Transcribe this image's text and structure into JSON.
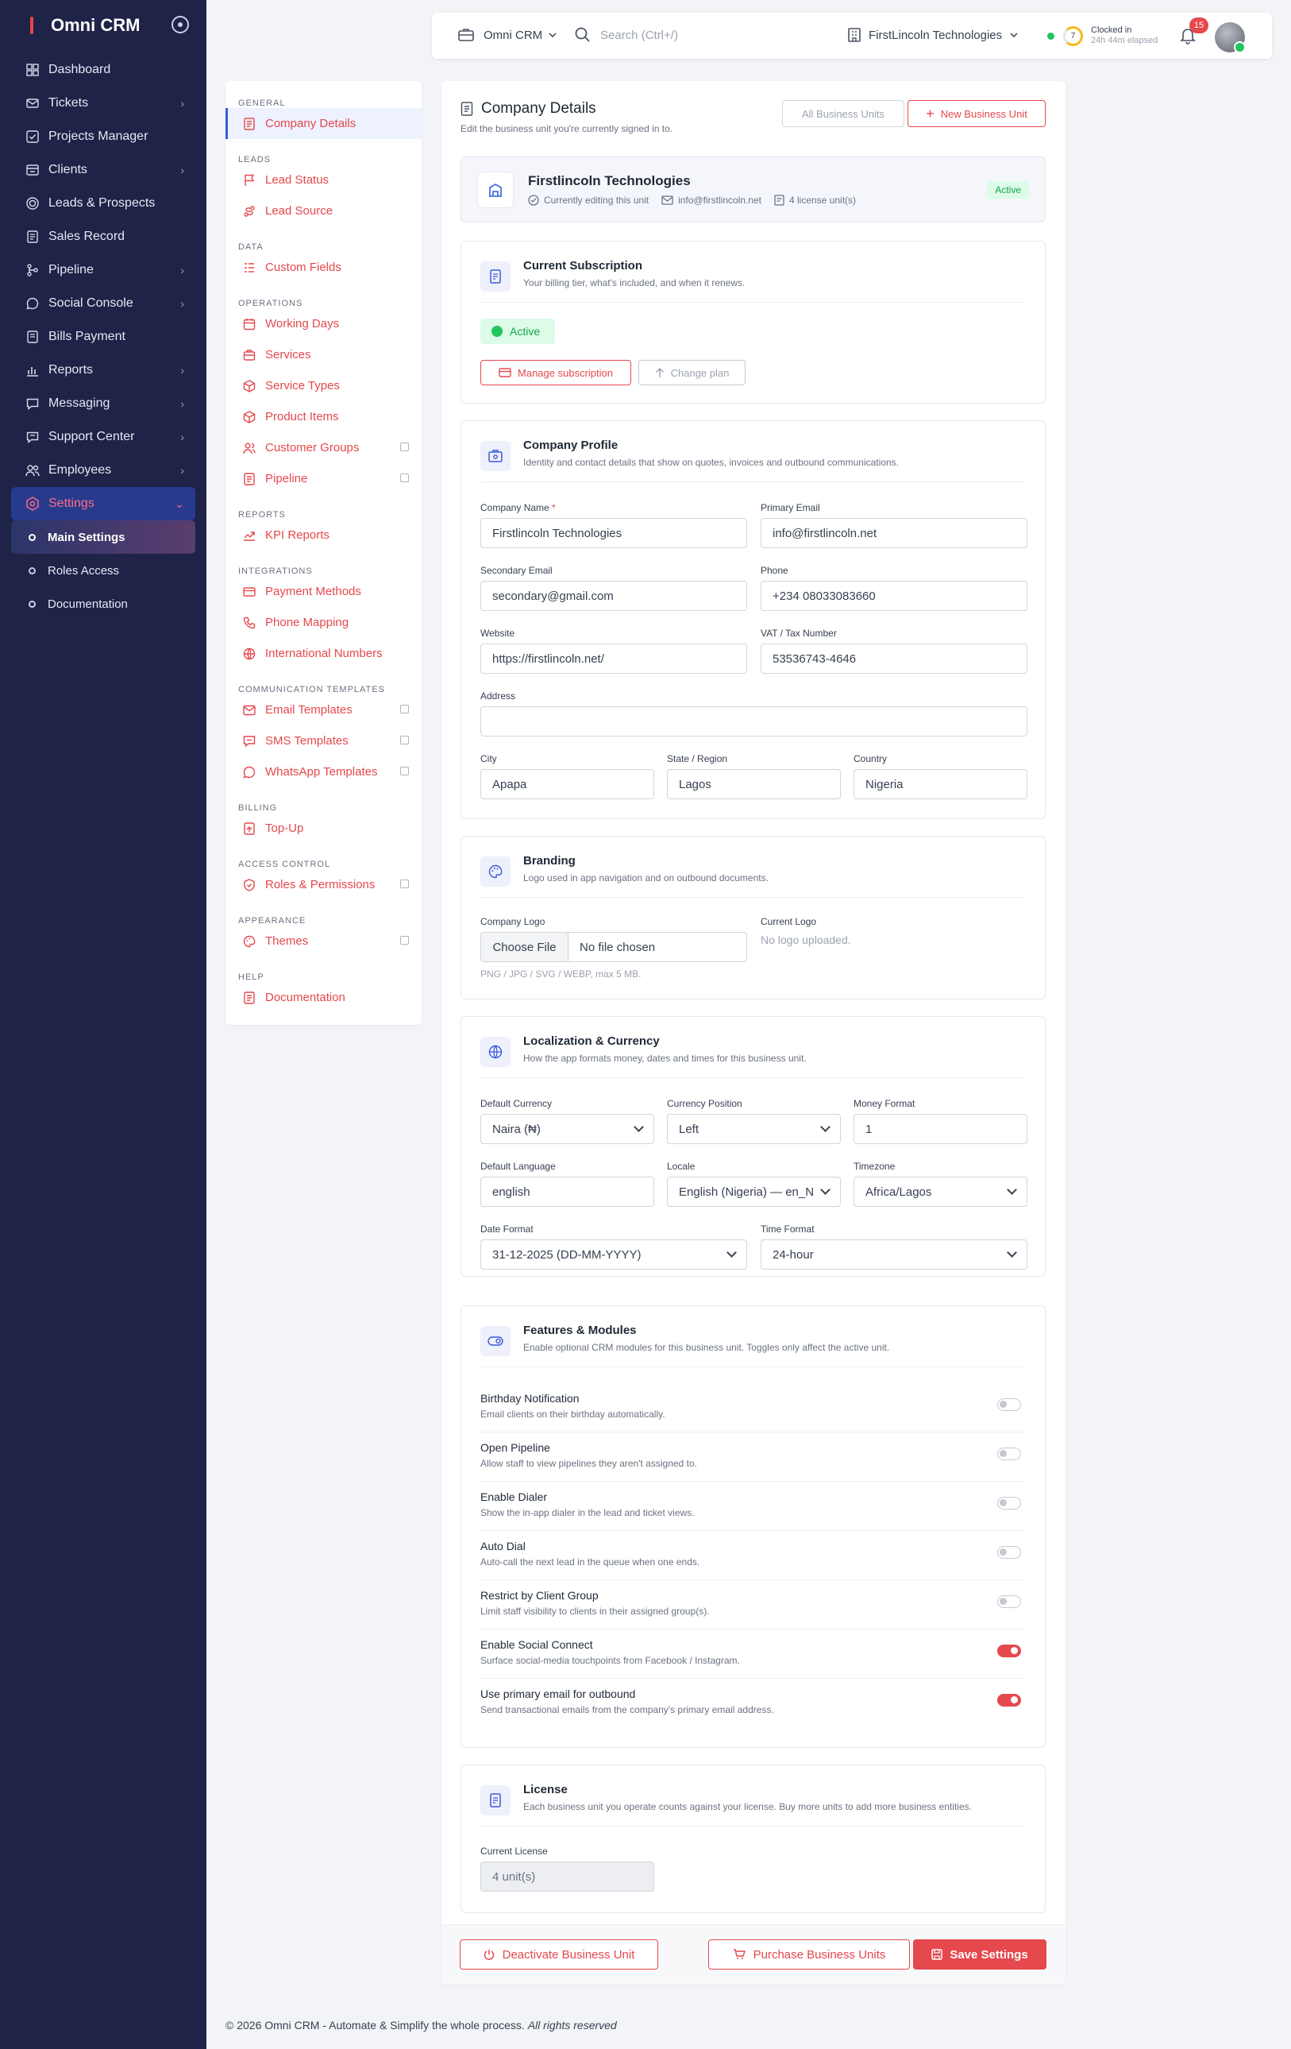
{
  "sidebar": {
    "title": "Omni CRM",
    "items": [
      {
        "label": "Dashboard",
        "icon": "dashboard-icon",
        "chevron": false
      },
      {
        "label": "Tickets",
        "icon": "ticket-icon",
        "chevron": true
      },
      {
        "label": "Projects Manager",
        "icon": "checkbox-icon",
        "chevron": false
      },
      {
        "label": "Clients",
        "icon": "clients-icon",
        "chevron": true
      },
      {
        "label": "Leads & Prospects",
        "icon": "target-icon",
        "chevron": false
      },
      {
        "label": "Sales Record",
        "icon": "document-icon",
        "chevron": false
      },
      {
        "label": "Pipeline",
        "icon": "pipeline-icon",
        "chevron": true
      },
      {
        "label": "Social Console",
        "icon": "chat-icon",
        "chevron": true
      },
      {
        "label": "Bills Payment",
        "icon": "bill-icon",
        "chevron": false
      },
      {
        "label": "Reports",
        "icon": "chart-icon",
        "chevron": true
      },
      {
        "label": "Messaging",
        "icon": "message-icon",
        "chevron": true
      },
      {
        "label": "Support Center",
        "icon": "support-icon",
        "chevron": true
      },
      {
        "label": "Employees",
        "icon": "people-icon",
        "chevron": true
      },
      {
        "label": "Settings",
        "icon": "settings-icon",
        "chevron": true
      }
    ],
    "subitems": [
      {
        "label": "Main Settings"
      },
      {
        "label": "Roles Access"
      },
      {
        "label": "Documentation"
      }
    ]
  },
  "topbar": {
    "app": "Omni CRM",
    "search_placeholder": "Search (Ctrl+/)",
    "company": "FirstLincoln Technologies",
    "clock_value": "7",
    "clock_title": "Clocked in",
    "clock_elapsed": "24h 44m elapsed",
    "notifications": "15"
  },
  "settings_nav": [
    {
      "section": "GENERAL",
      "items": [
        {
          "label": "Company Details",
          "icon": "document-icon",
          "ext": false,
          "active": true
        }
      ]
    },
    {
      "section": "LEADS",
      "items": [
        {
          "label": "Lead Status",
          "icon": "flag-icon",
          "ext": false
        },
        {
          "label": "Lead Source",
          "icon": "route-icon",
          "ext": false
        }
      ]
    },
    {
      "section": "DATA",
      "items": [
        {
          "label": "Custom Fields",
          "icon": "list-icon",
          "ext": false
        }
      ]
    },
    {
      "section": "OPERATIONS",
      "items": [
        {
          "label": "Working Days",
          "icon": "calendar-icon",
          "ext": false
        },
        {
          "label": "Services",
          "icon": "briefcase-icon",
          "ext": false
        },
        {
          "label": "Service Types",
          "icon": "box-icon",
          "ext": false
        },
        {
          "label": "Product Items",
          "icon": "box-icon",
          "ext": false
        },
        {
          "label": "Customer Groups",
          "icon": "users-icon",
          "ext": true
        },
        {
          "label": "Pipeline",
          "icon": "chart-icon",
          "ext": true
        }
      ]
    },
    {
      "section": "REPORTS",
      "items": [
        {
          "label": "KPI Reports",
          "icon": "trend-icon",
          "ext": false
        }
      ]
    },
    {
      "section": "INTEGRATIONS",
      "items": [
        {
          "label": "Payment Methods",
          "icon": "card-icon",
          "ext": false
        },
        {
          "label": "Phone Mapping",
          "icon": "phone-icon",
          "ext": false
        },
        {
          "label": "International Numbers",
          "icon": "globe-icon",
          "ext": false
        }
      ]
    },
    {
      "section": "COMMUNICATION TEMPLATES",
      "items": [
        {
          "label": "Email Templates",
          "icon": "mail-icon",
          "ext": true
        },
        {
          "label": "SMS Templates",
          "icon": "sms-icon",
          "ext": true
        },
        {
          "label": "WhatsApp Templates",
          "icon": "whatsapp-icon",
          "ext": true
        }
      ]
    },
    {
      "section": "BILLING",
      "items": [
        {
          "label": "Top-Up",
          "icon": "topup-icon",
          "ext": false
        }
      ]
    },
    {
      "section": "ACCESS CONTROL",
      "items": [
        {
          "label": "Roles & Permissions",
          "icon": "shield-icon",
          "ext": true
        }
      ]
    },
    {
      "section": "APPEARANCE",
      "items": [
        {
          "label": "Themes",
          "icon": "palette-icon",
          "ext": true
        }
      ]
    },
    {
      "section": "HELP",
      "items": [
        {
          "label": "Documentation",
          "icon": "document-icon",
          "ext": false
        }
      ]
    }
  ],
  "main": {
    "title": "Company Details",
    "subtitle": "Edit the business unit you're currently signed in to.",
    "all_units_label": "All Business Units",
    "new_unit_label": "New Business Unit",
    "unit": {
      "name": "Firstlincoln Technologies",
      "editing": "Currently editing this unit",
      "email": "info@firstlincoln.net",
      "license": "4 license unit(s)",
      "status": "Active"
    },
    "subscription": {
      "title": "Current Subscription",
      "subtitle": "Your billing tier, what's included, and when it renews.",
      "status": "Active",
      "manage_label": "Manage subscription",
      "change_label": "Change plan"
    },
    "profile": {
      "title": "Company Profile",
      "subtitle": "Identity and contact details that show on quotes, invoices and outbound communications.",
      "company_name_label": "Company Name",
      "company_name": "Firstlincoln Technologies",
      "primary_email_label": "Primary Email",
      "primary_email": "info@firstlincoln.net",
      "secondary_email_label": "Secondary Email",
      "secondary_email": "secondary@gmail.com",
      "phone_label": "Phone",
      "phone": "+234 08033083660",
      "website_label": "Website",
      "website": "https://firstlincoln.net/",
      "vat_label": "VAT / Tax Number",
      "vat": "53536743-4646",
      "address_label": "Address",
      "address": "",
      "city_label": "City",
      "city": "Apapa",
      "state_label": "State / Region",
      "state": "Lagos",
      "country_label": "Country",
      "country": "Nigeria"
    },
    "branding": {
      "title": "Branding",
      "subtitle": "Logo used in app navigation and on outbound documents.",
      "logo_label": "Company Logo",
      "choose_file": "Choose File",
      "no_file": "No file chosen",
      "hint": "PNG / JPG / SVG / WEBP, max 5 MB.",
      "current_logo_label": "Current Logo",
      "no_logo": "No logo uploaded."
    },
    "localization": {
      "title": "Localization & Currency",
      "subtitle": "How the app formats money, dates and times for this business unit.",
      "currency_label": "Default Currency",
      "currency": "Naira (₦)",
      "position_label": "Currency Position",
      "position": "Left",
      "money_label": "Money Format",
      "money": "1",
      "language_label": "Default Language",
      "language": "english",
      "locale_label": "Locale",
      "locale": "English (Nigeria) — en_N",
      "timezone_label": "Timezone",
      "timezone": "Africa/Lagos",
      "date_label": "Date Format",
      "date": "31-12-2025 (DD-MM-YYYY)",
      "time_label": "Time Format",
      "time": "24-hour"
    },
    "features": {
      "title": "Features & Modules",
      "subtitle": "Enable optional CRM modules for this business unit. Toggles only affect the active unit.",
      "items": [
        {
          "title": "Birthday Notification",
          "desc": "Email clients on their birthday automatically.",
          "on": false
        },
        {
          "title": "Open Pipeline",
          "desc": "Allow staff to view pipelines they aren't assigned to.",
          "on": false
        },
        {
          "title": "Enable Dialer",
          "desc": "Show the in-app dialer in the lead and ticket views.",
          "on": false
        },
        {
          "title": "Auto Dial",
          "desc": "Auto-call the next lead in the queue when one ends.",
          "on": false
        },
        {
          "title": "Restrict by Client Group",
          "desc": "Limit staff visibility to clients in their assigned group(s).",
          "on": false
        },
        {
          "title": "Enable Social Connect",
          "desc": "Surface social-media touchpoints from Facebook / Instagram.",
          "on": true
        },
        {
          "title": "Use primary email for outbound",
          "desc": "Send transactional emails from the company's primary email address.",
          "on": true
        }
      ]
    },
    "license": {
      "title": "License",
      "subtitle": "Each business unit you operate counts against your license. Buy more units to add more business entities.",
      "label": "Current License",
      "value": "4 unit(s)"
    },
    "footer": {
      "deactivate": "Deactivate Business Unit",
      "purchase": "Purchase Business Units",
      "save": "Save Settings"
    }
  },
  "copyright": {
    "text": "© 2026 Omni CRM - Automate & Simplify the whole process.",
    "rights": "All rights reserved"
  },
  "colors": {
    "sidebar": "#1f2347",
    "accent": "#e5484d",
    "link": "#3b5bdb",
    "success": "#22c55e"
  }
}
